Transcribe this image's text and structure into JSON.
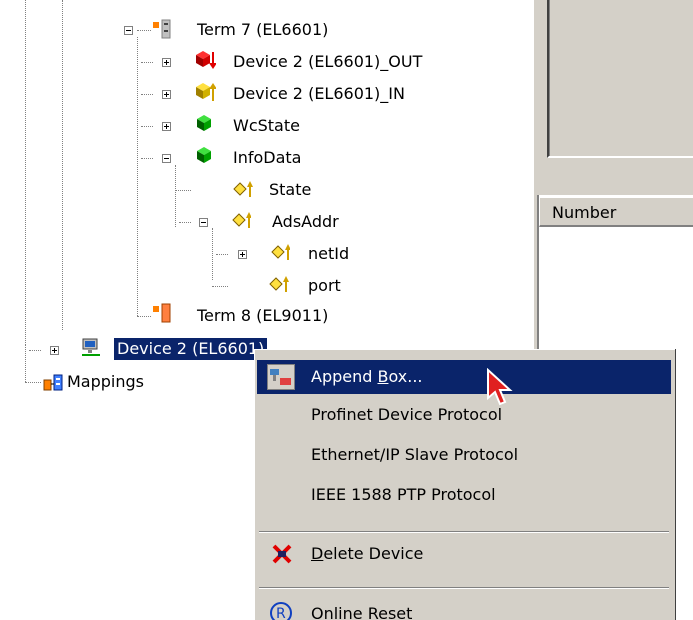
{
  "tree": {
    "term7": "Term 7 (EL6601)",
    "out": "Device 2 (EL6601)_OUT",
    "in": "Device 2 (EL6601)_IN",
    "wcstate": "WcState",
    "infodata": "InfoData",
    "state": "State",
    "adsaddr": "AdsAddr",
    "netid": "netId",
    "port": "port",
    "term8": "Term 8 (EL9011)",
    "device2": "Device 2 (EL6601)",
    "mappings": "Mappings"
  },
  "list": {
    "column_number": "Number"
  },
  "context_menu": {
    "append_box": {
      "pre": "Append ",
      "key": "B",
      "post": "ox..."
    },
    "profinet": "Profinet Device Protocol",
    "ethernetip": "Ethernet/IP Slave Protocol",
    "ieee1588": "IEEE 1588 PTP Protocol",
    "delete_device": {
      "key": "D",
      "post": "elete Device"
    },
    "online_reset": "Online Reset"
  },
  "icons": {
    "term": "terminal-icon",
    "out": "output-variable-icon",
    "in": "input-variable-icon",
    "group": "variable-group-icon",
    "var": "variable-icon",
    "device": "network-device-icon",
    "mappings": "mappings-icon",
    "append": "append-box-icon",
    "delete": "delete-device-icon",
    "reset": "online-reset-icon"
  },
  "colors": {
    "selection": "#0a246a",
    "menu_bg": "#d4d0c8"
  }
}
